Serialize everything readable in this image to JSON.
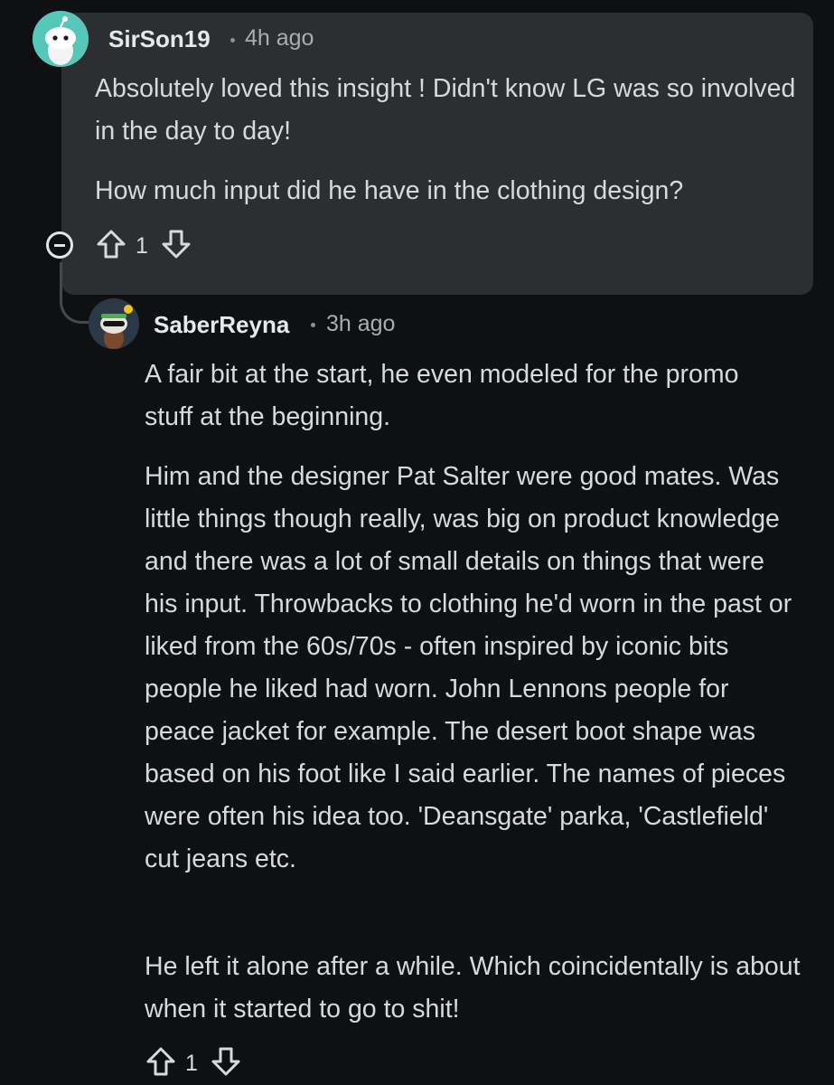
{
  "comments": [
    {
      "username": "SirSon19",
      "time": "4h ago",
      "paragraphs": [
        "Absolutely loved this insight ! Didn't know LG was so involved in the day to day!",
        "How much input did he have in the clothing design?"
      ],
      "votes": "1",
      "icons": {
        "avatar": "snoo-avatar",
        "upvote": "upvote-arrow-icon",
        "downvote": "downvote-arrow-icon",
        "collapse": "collapse-minus-icon"
      }
    },
    {
      "username": "SaberReyna",
      "time": "3h ago",
      "paragraphs": [
        "A fair bit at the start, he even modeled for the promo stuff at the beginning.",
        "Him and the designer Pat Salter were good mates. Was little things though really, was big on product knowledge and there was a lot of small details on things that were his input. Throwbacks to clothing he'd worn in the past or liked from the 60s/70s - often inspired by iconic bits people he liked had worn. John Lennons people for peace jacket for example. The desert boot shape was based on his foot like I said earlier. The names of pieces were often his idea too. 'Deansgate' parka, 'Castlefield' cut jeans etc.",
        "He left it alone after a while. Which coincidentally is about when it started to go to shit!"
      ],
      "votes": "1",
      "icons": {
        "avatar": "snoo-avatar",
        "upvote": "upvote-arrow-icon",
        "downvote": "downvote-arrow-icon"
      }
    }
  ],
  "colors": {
    "background": "#0f1012",
    "highlight_card": "#2c2e31",
    "text": "#d7dadd",
    "meta": "#a8adb2",
    "avatar1": "#57c7ba",
    "avatar2": "#2b3947"
  }
}
